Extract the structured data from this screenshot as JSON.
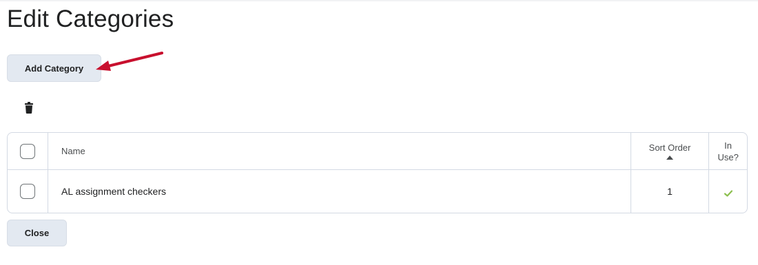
{
  "page": {
    "title": "Edit Categories"
  },
  "toolbar": {
    "add_label": "Add Category",
    "delete_icon": "trash-icon"
  },
  "table": {
    "headers": {
      "name": "Name",
      "sort_order": "Sort Order",
      "in_use_line1": "In",
      "in_use_line2": "Use?"
    },
    "rows": [
      {
        "name": "AL assignment checkers",
        "sort_order": "1",
        "in_use": true
      }
    ]
  },
  "footer": {
    "close_label": "Close"
  },
  "colors": {
    "button_bg": "#e3e9f1",
    "border": "#d3d9e3",
    "check_green": "#8cbf4f",
    "annotation_arrow": "#c8102e"
  }
}
